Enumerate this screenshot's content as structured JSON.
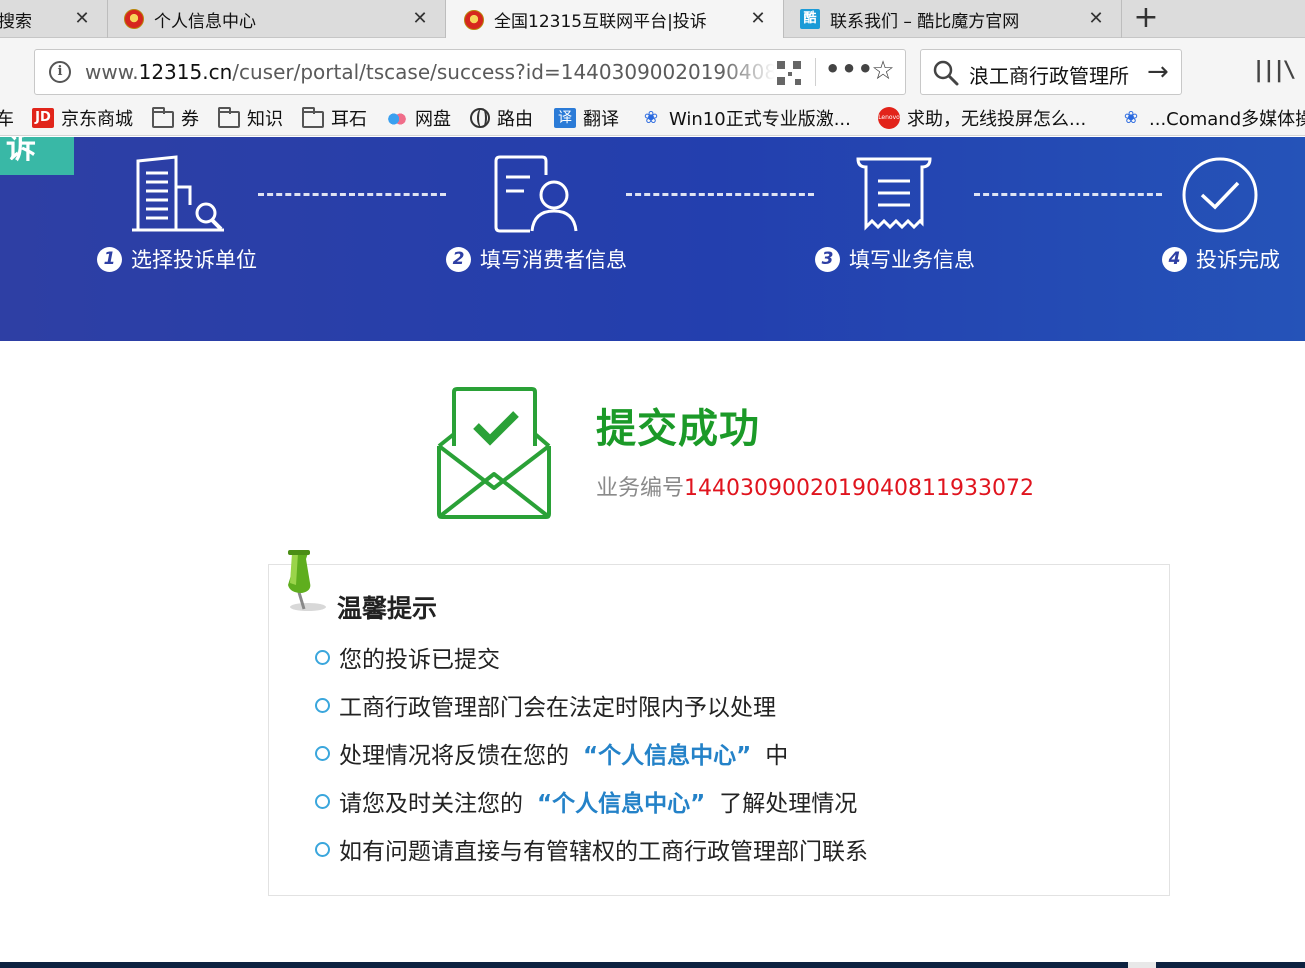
{
  "browser": {
    "tabs": [
      {
        "title": "搜索",
        "favicon": "none",
        "active": false
      },
      {
        "title": "个人信息中心",
        "favicon": "national-emblem-icon",
        "active": false
      },
      {
        "title": "全国12315互联网平台|投诉",
        "favicon": "national-emblem-icon",
        "active": true
      },
      {
        "title": "联系我们 – 酷比魔方官网",
        "favicon": "kubi-icon",
        "active": false
      }
    ],
    "close_glyph": "✕",
    "new_tab_glyph": "+",
    "url": {
      "prefix": "www.",
      "domain": "12315.cn",
      "path": "/cuser/portal/tscase/success?id=14403090020190408"
    },
    "more_glyph": "•••",
    "star_glyph": "☆",
    "search_text": "浪工商行政管理所",
    "search_go_glyph": "→",
    "library_glyph": "|||\\",
    "bookmarks": [
      {
        "label": "车",
        "icon": "none"
      },
      {
        "label": "京东商城",
        "icon": "jd-icon",
        "icon_text": "JD"
      },
      {
        "label": "券",
        "icon": "folder-icon"
      },
      {
        "label": "知识",
        "icon": "folder-icon"
      },
      {
        "label": "耳石",
        "icon": "folder-icon"
      },
      {
        "label": "网盘",
        "icon": "cloud-icon"
      },
      {
        "label": "路由",
        "icon": "globe-icon"
      },
      {
        "label": "翻译",
        "icon": "translate-icon",
        "icon_text": "译"
      },
      {
        "label": "Win10正式专业版激...",
        "icon": "baidu-paw-icon"
      },
      {
        "label": "求助，无线投屏怎么...",
        "icon": "lenovo-icon",
        "icon_text": "Lenovo"
      },
      {
        "label": "...Comand多媒体操",
        "icon": "baidu-paw-icon"
      }
    ]
  },
  "banner": {
    "corner_text": "诉",
    "steps": [
      {
        "number": "1",
        "label": "选择投诉单位",
        "icon": "building-search-icon"
      },
      {
        "number": "2",
        "label": "填写消费者信息",
        "icon": "user-card-icon"
      },
      {
        "number": "3",
        "label": "填写业务信息",
        "icon": "receipt-icon"
      },
      {
        "number": "4",
        "label": "投诉完成",
        "icon": "check-circle-icon"
      }
    ]
  },
  "result": {
    "title": "提交成功",
    "biz_label": "业务编号",
    "biz_number": "1440309002019040811933072"
  },
  "tips": {
    "title": "温馨提示",
    "items": [
      {
        "text": "您的投诉已提交"
      },
      {
        "text": "工商行政管理部门会在法定时限内予以处理"
      },
      {
        "before": "处理情况将反馈在您的",
        "highlight": "“个人信息中心”",
        "after": "中"
      },
      {
        "before": "请您及时关注您的",
        "highlight": "“个人信息中心”",
        "after": "了解处理情况"
      },
      {
        "text": "如有问题请直接与有管辖权的工商行政管理部门联系"
      }
    ]
  },
  "colors": {
    "banner": "#233fae",
    "success_green": "#1b9a28",
    "number_red": "#e0141e",
    "highlight_blue": "#2482c8",
    "bullet_blue": "#3aa6dc"
  }
}
